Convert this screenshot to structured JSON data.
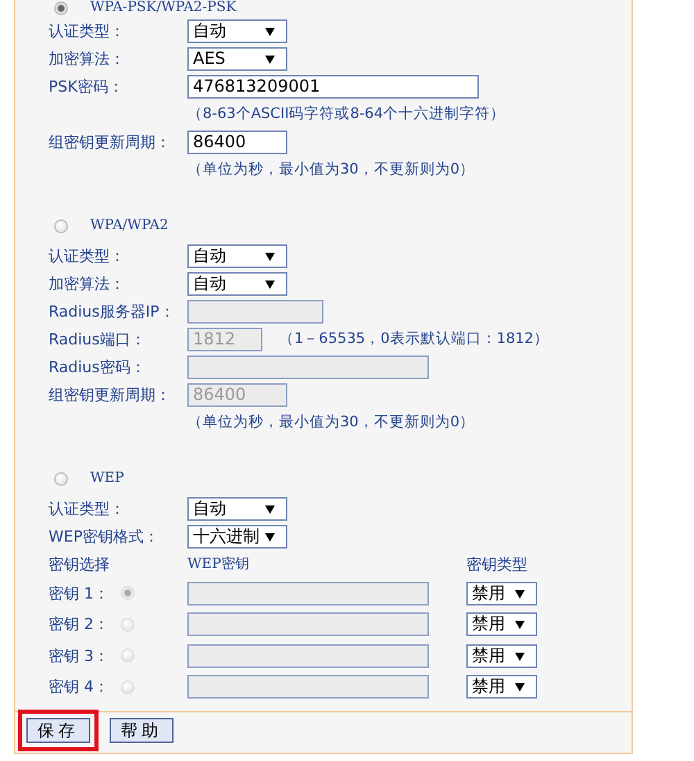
{
  "sections": [
    {
      "title": "WPA-PSK/WPA2-PSK",
      "selected": true,
      "rows": [
        {
          "kind": "select",
          "label": "认证类型：",
          "value": "自动",
          "disabled": false
        },
        {
          "kind": "select",
          "label": "加密算法：",
          "value": "AES",
          "disabled": false
        },
        {
          "kind": "key-field",
          "label": "PSK密码：",
          "value": "476813209001",
          "disabled": false
        },
        {
          "kind": "hint",
          "text": "（8-63个ASCII码字符或8-64个十六进制字符）"
        },
        {
          "kind": "number-field",
          "label": "组密钥更新周期：",
          "value": "86400",
          "disabled": false
        },
        {
          "kind": "hint",
          "text": "（单位为秒，最小值为30，不更新则为0）"
        }
      ]
    },
    {
      "title": "WPA/WPA2",
      "selected": false,
      "rows": [
        {
          "kind": "select",
          "label": "认证类型：",
          "value": "自动",
          "disabled": false
        },
        {
          "kind": "select",
          "label": "加密算法：",
          "value": "自动",
          "disabled": false
        },
        {
          "kind": "address-field",
          "label": "Radius服务器IP：",
          "value": "",
          "disabled": true
        },
        {
          "kind": "port-field",
          "label": "Radius端口：",
          "value": "1812",
          "disabled": true,
          "note": "（1－65535，0表示默认端口：1812）"
        },
        {
          "kind": "secret-field",
          "label": "Radius密码：",
          "value": "",
          "disabled": true
        },
        {
          "kind": "number-field",
          "label": "组密钥更新周期：",
          "value": "86400",
          "disabled": true
        },
        {
          "kind": "hint",
          "text": "（单位为秒，最小值为30，不更新则为0）"
        }
      ]
    },
    {
      "title": "WEP",
      "selected": false,
      "rows": [
        {
          "kind": "select",
          "label": "认证类型：",
          "value": "自动",
          "disabled": false
        },
        {
          "kind": "select",
          "label": "WEP密钥格式：",
          "value": "十六进制",
          "disabled": false
        }
      ]
    }
  ],
  "wep_keys": {
    "headers": [
      "密钥选择",
      "WEP密钥",
      "密钥类型"
    ],
    "keys": [
      {
        "label": "密钥 1：",
        "selected": true,
        "disabled": true,
        "type": "禁用"
      },
      {
        "label": "密钥 2：",
        "selected": false,
        "disabled": true,
        "type": "禁用"
      },
      {
        "label": "密钥 3：",
        "selected": false,
        "disabled": true,
        "type": "禁用"
      },
      {
        "label": "密钥 4：",
        "selected": false,
        "disabled": true,
        "type": "禁用"
      }
    ]
  },
  "buttons": [
    {
      "label": "保存",
      "highlighted": true
    },
    {
      "label": "帮助",
      "highlighted": false
    }
  ]
}
